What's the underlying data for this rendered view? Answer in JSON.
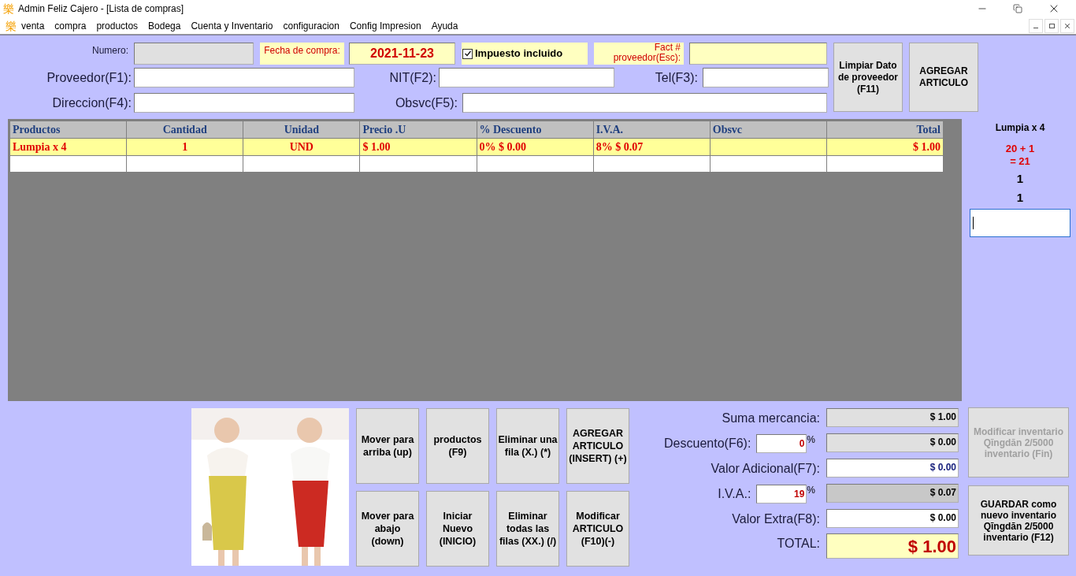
{
  "window": {
    "app_icon": "樂",
    "title": "Admin  Feliz Cajero - [Lista de compras]"
  },
  "menu": {
    "app_icon": "樂",
    "items": [
      "venta",
      "compra",
      "productos",
      "Bodega",
      "Cuenta y Inventario",
      "configuracion",
      "Config Impresion",
      "Ayuda"
    ]
  },
  "header": {
    "numero": {
      "label": "Numero:"
    },
    "fecha": {
      "label": "Fecha de compra:",
      "value": "2021-11-23"
    },
    "impuesto": {
      "label": "Impuesto incluido",
      "checked": true
    },
    "factura": {
      "label": "Fact # proveedor(Esc):"
    },
    "proveedor": {
      "label": "Proveedor(F1):"
    },
    "nit": {
      "label": "NIT(F2):"
    },
    "tel": {
      "label": "Tel(F3):"
    },
    "direccion": {
      "label": "Direccion(F4):"
    },
    "obsvc": {
      "label": "Obsvc(F5):"
    }
  },
  "top_buttons": [
    "Limpiar Dato de proveedor (F11)",
    "AGREGAR ARTICULO"
  ],
  "table": {
    "columns": [
      "Productos",
      "Cantidad",
      "Unidad",
      "Precio .U",
      "% Descuento",
      "I.V.A.",
      "Obsvc",
      "Total"
    ],
    "rows": [
      {
        "cells": [
          "Lumpia x 4",
          "1",
          "UND",
          "$ 1.00",
          "0% $ 0.00",
          "8% $ 0.07",
          "",
          "$ 1.00"
        ],
        "selected": true
      }
    ]
  },
  "side": {
    "product": "Lumpia x 4",
    "formula": [
      "20 + 1",
      "= 21"
    ],
    "lines": [
      "1",
      "1"
    ]
  },
  "actions": [
    {
      "label": "Mover para arriba (up)"
    },
    {
      "label": "productos (F9)"
    },
    {
      "label": "Eliminar una fila (X.) (*)"
    },
    {
      "label": "AGREGAR ARTICULO (INSERT) (+)"
    },
    {
      "label": "Mover para abajo (down)"
    },
    {
      "label": "Iniciar Nuevo (INICIO)"
    },
    {
      "label": "Eliminar todas las filas (XX.) (/)"
    },
    {
      "label": "Modificar ARTICULO (F10)(-)"
    }
  ],
  "summary": [
    {
      "kind": "readonly",
      "label": "Suma mercancia:",
      "value": "$ 1.00"
    },
    {
      "kind": "readonly",
      "label": "Descuento(F6):",
      "percent": "0",
      "percent_sign": "%",
      "value": "$ 0.00"
    },
    {
      "kind": "blue",
      "label": "Valor Adicional(F7):",
      "value": "$ 0.00"
    },
    {
      "kind": "shaded",
      "label": "I.V.A.:",
      "percent": "19",
      "percent_sign": "%",
      "value": "$ 0.07"
    },
    {
      "kind": "entry",
      "label": "Valor Extra(F8):",
      "value": "$ 0.00"
    },
    {
      "kind": "total",
      "label": "TOTAL:",
      "value": "$ 1.00"
    }
  ],
  "side_buttons": [
    {
      "label": "Modificar inventario Qīngdān 2/5000 inventario (Fin)",
      "disabled": true
    },
    {
      "label": "GUARDAR como nuevo inventario Qīngdān 2/5000 inventario (F12)",
      "disabled": false
    }
  ]
}
